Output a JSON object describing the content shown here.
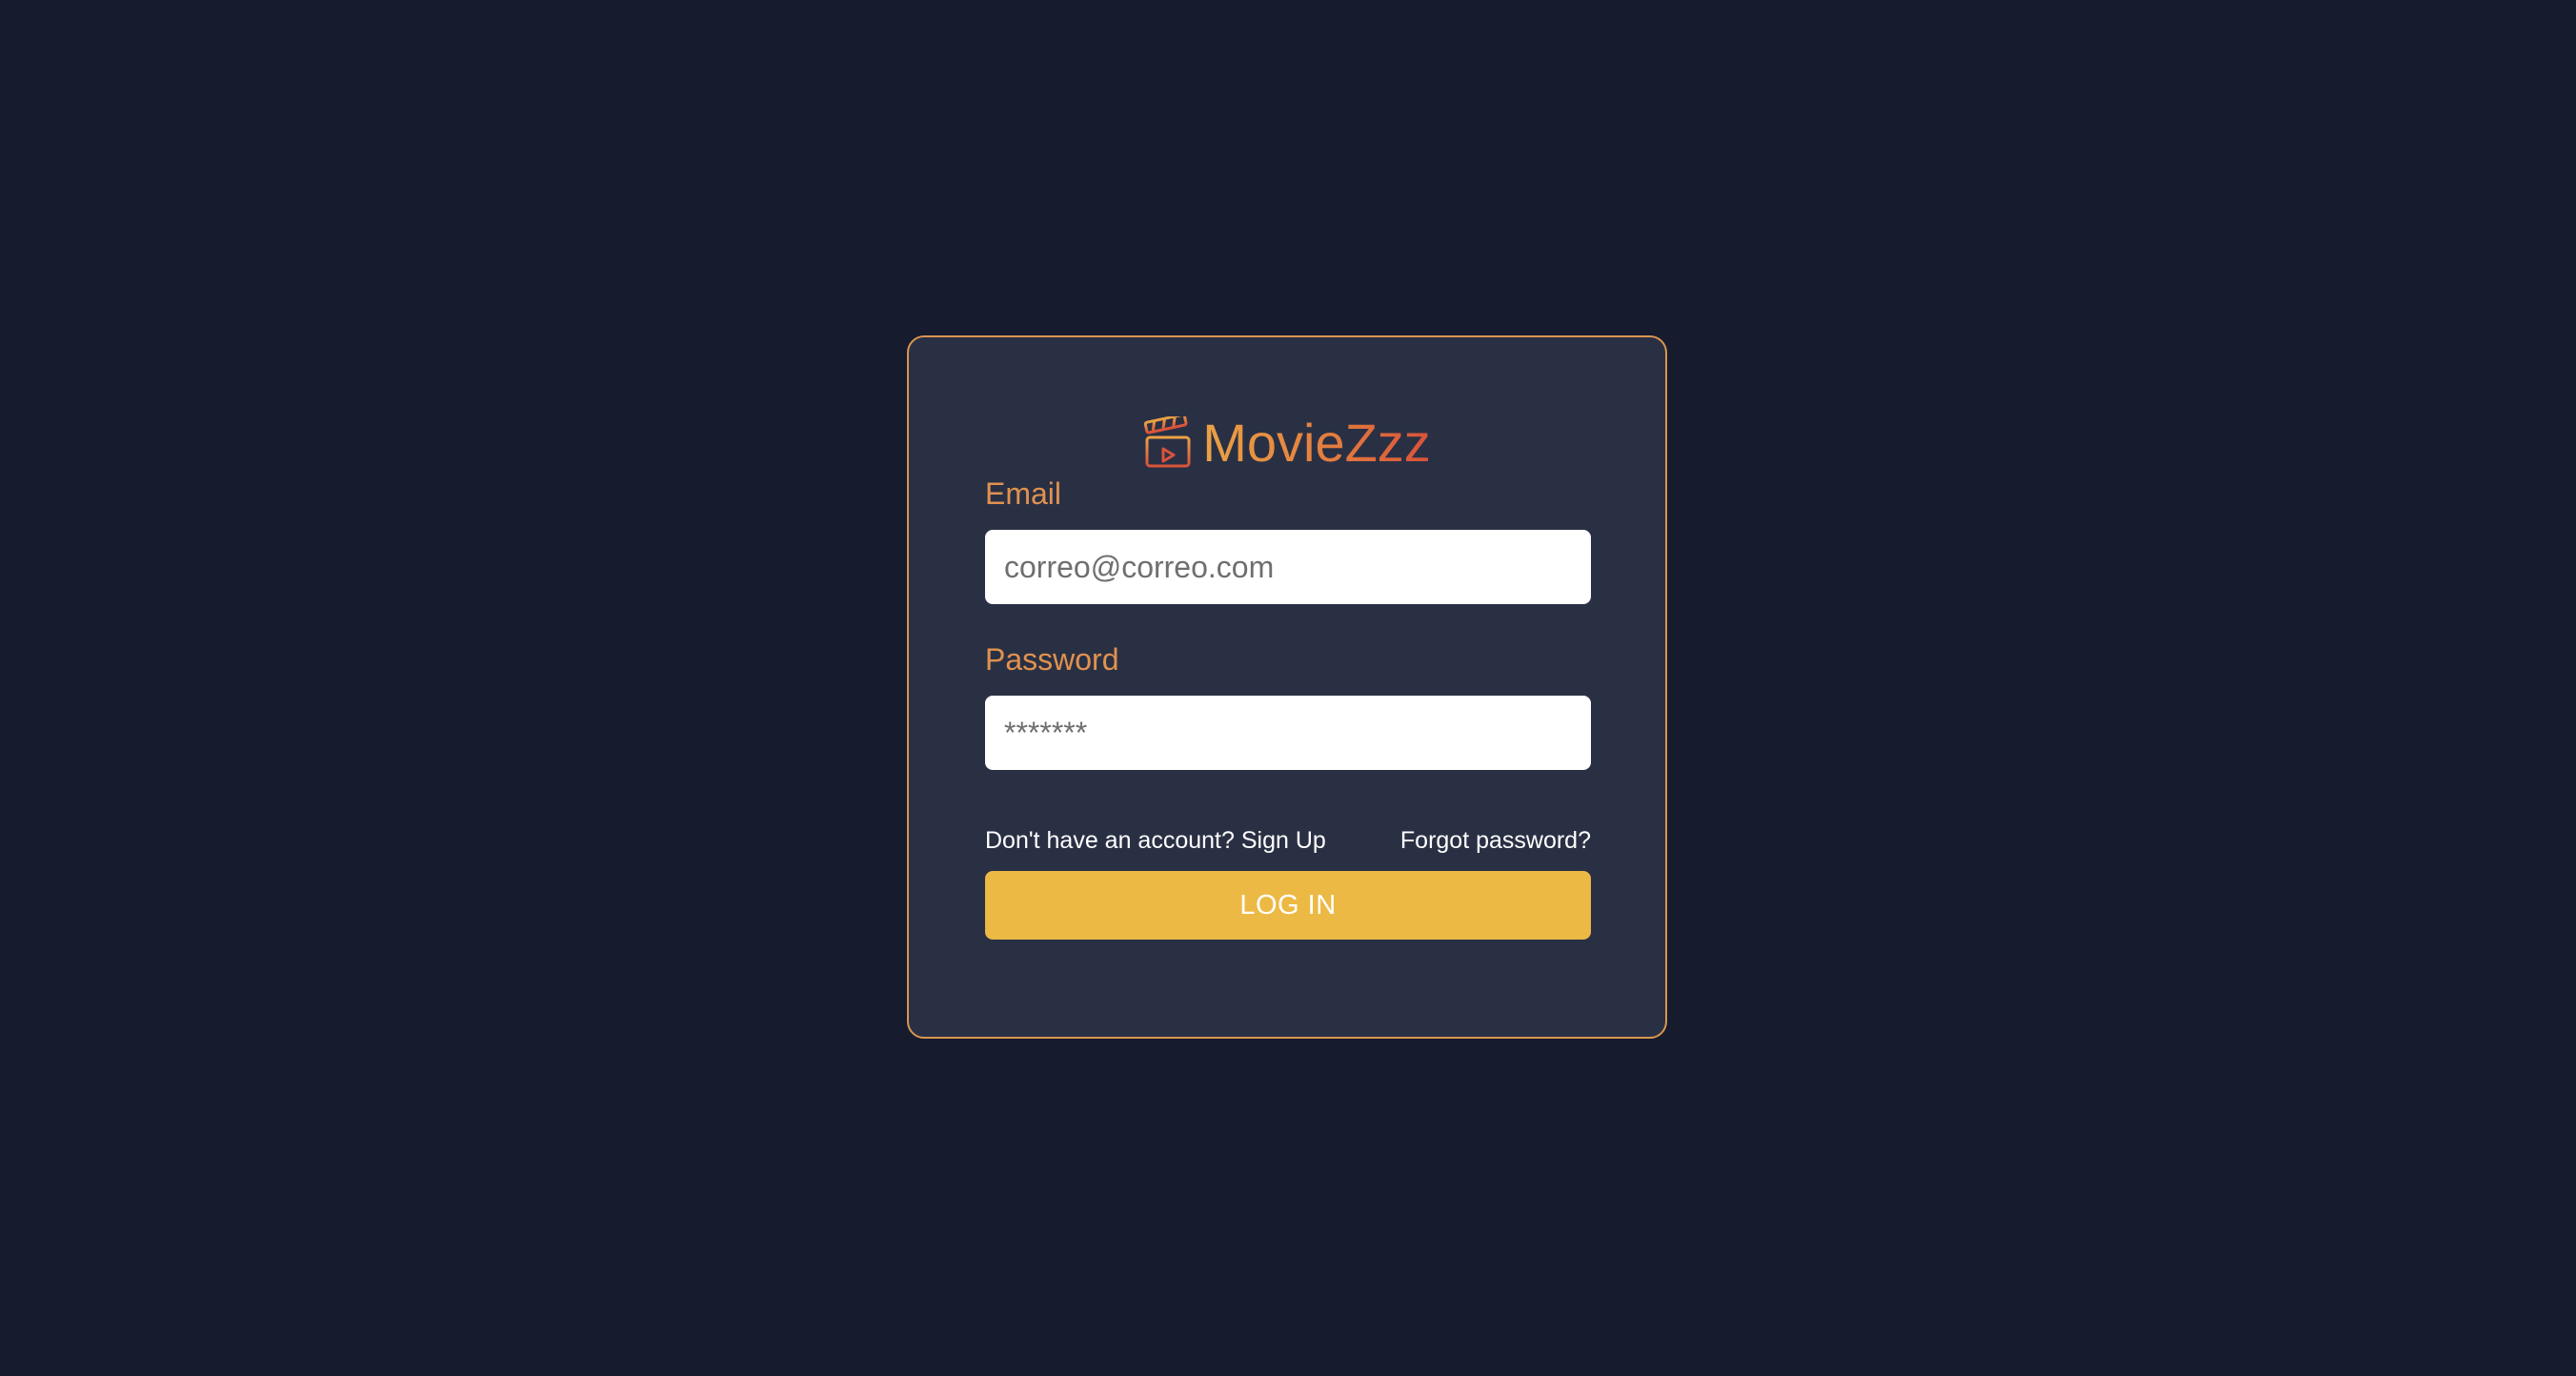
{
  "brand": {
    "name": "MovieZzz",
    "icon": "clapperboard-icon"
  },
  "form": {
    "email_label": "Email",
    "email_placeholder": "correo@correo.com",
    "email_value": "",
    "password_label": "Password",
    "password_placeholder": "*******",
    "password_value": "",
    "signup_link": "Don't have an account? Sign Up",
    "forgot_link": "Forgot password?",
    "login_button": "LOG IN"
  },
  "colors": {
    "background": "#161b2e",
    "card": "#2a3044",
    "card_border": "#d9954f",
    "label": "#e0924e",
    "button": "#ecb945"
  }
}
